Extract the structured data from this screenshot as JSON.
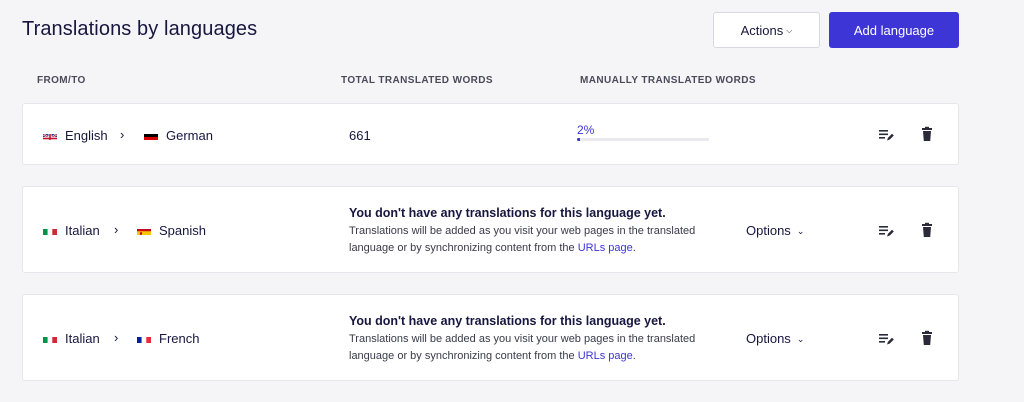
{
  "header": {
    "title": "Translations by languages",
    "actions_label": "Actions",
    "add_label": "Add language"
  },
  "columns": {
    "from_to": "FROM/TO",
    "total": "TOTAL TRANSLATED WORDS",
    "manual": "MANUALLY TRANSLATED WORDS"
  },
  "rows": [
    {
      "from": "English",
      "from_flag": "uk-flag-icon",
      "to": "German",
      "to_flag": "germany-flag-icon",
      "total_words": "661",
      "manual_percent_label": "2%",
      "manual_percent": 2
    },
    {
      "from": "Italian",
      "from_flag": "italy-flag-icon",
      "to": "Spanish",
      "to_flag": "spain-flag-icon",
      "empty_title": "You don't have any translations for this language yet.",
      "empty_body": "Translations will be added as you visit your web pages in the translated language or by synchronizing content from the ",
      "empty_link": "URLs page",
      "empty_tail": ".",
      "options_label": "Options"
    },
    {
      "from": "Italian",
      "from_flag": "italy-flag-icon",
      "to": "French",
      "to_flag": "france-flag-icon",
      "empty_title": "You don't have any translations for this language yet.",
      "empty_body": "Translations will be added as you visit your web pages in the translated language or by synchronizing content from the ",
      "empty_link": "URLs page",
      "empty_tail": ".",
      "options_label": "Options"
    }
  ],
  "colors": {
    "accent": "#3d35d6",
    "text": "#16163f",
    "background": "#f5f5f7"
  }
}
